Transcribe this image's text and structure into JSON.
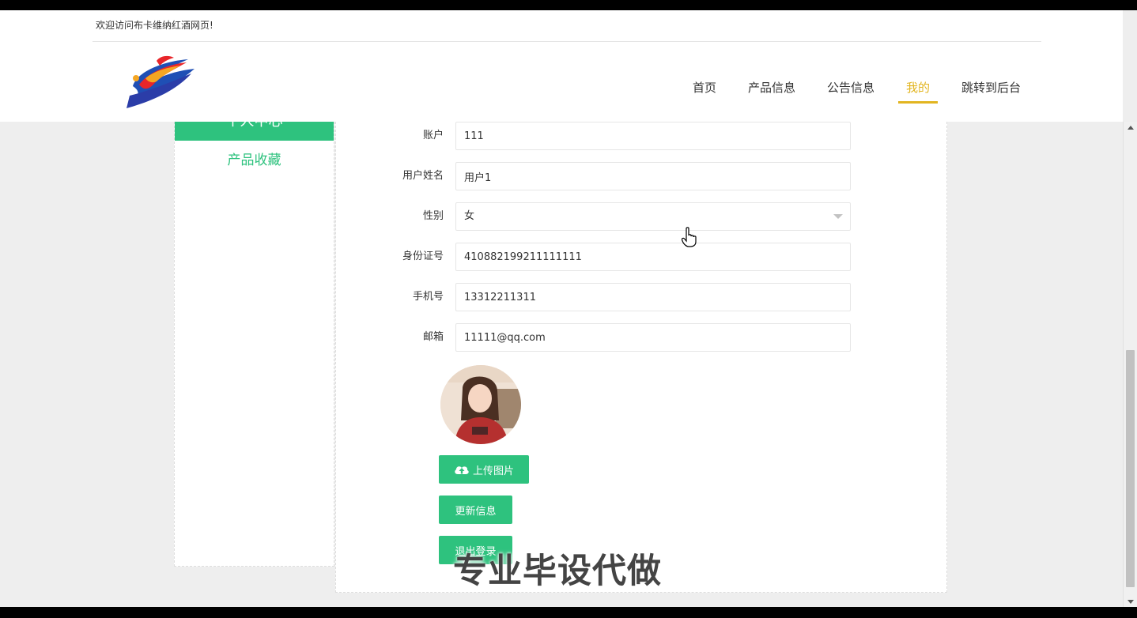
{
  "header": {
    "welcome": "欢迎访问布卡维纳红酒网页!",
    "nav": [
      {
        "label": "首页",
        "active": false
      },
      {
        "label": "产品信息",
        "active": false
      },
      {
        "label": "公告信息",
        "active": false
      },
      {
        "label": "我的",
        "active": true
      },
      {
        "label": "跳转到后台",
        "active": false
      }
    ]
  },
  "sidebar": {
    "title": "个人中心",
    "links": [
      {
        "label": "产品收藏"
      }
    ]
  },
  "form": {
    "fields": [
      {
        "label": "账户",
        "value": "111"
      },
      {
        "label": "用户姓名",
        "value": "用户1"
      },
      {
        "label": "性别",
        "value": "女",
        "type": "select"
      },
      {
        "label": "身份证号",
        "value": "410882199211111111"
      },
      {
        "label": "手机号",
        "value": "13312211311"
      },
      {
        "label": "邮箱",
        "value": "11111@qq.com"
      }
    ],
    "upload_label": "上传图片",
    "update_label": "更新信息",
    "logout_label": "退出登录"
  },
  "watermark": "专业毕设代做",
  "colors": {
    "accent_green": "#2ec27e",
    "nav_active": "#e2b521",
    "page_bg": "#eeeeee"
  },
  "icons": {
    "upload": "cloud-upload-icon",
    "cursor": "hand-pointer-icon"
  }
}
